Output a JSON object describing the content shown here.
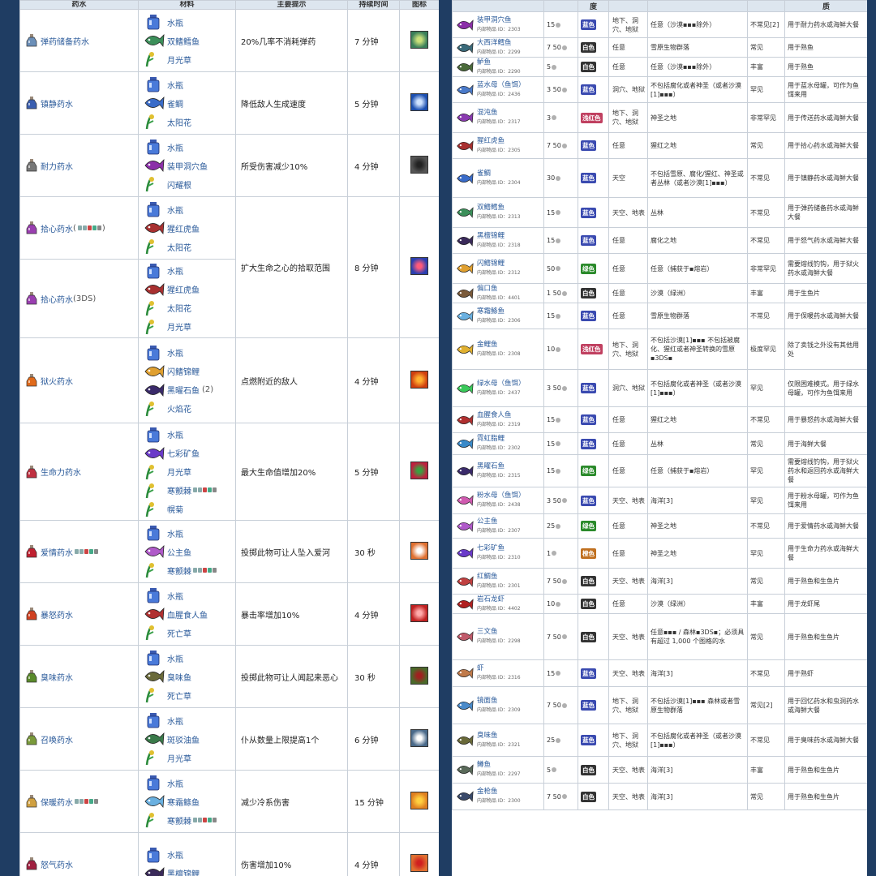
{
  "left": {
    "headers": [
      "药水",
      "材料",
      "主要提示",
      "持续时间",
      "图标"
    ],
    "rows": [
      {
        "name": "弹药储备药水",
        "pcolor": "#6b8fb8",
        "ings": [
          {
            "name": "水瓶",
            "ic": "bottle"
          },
          {
            "name": "双鳍鳕鱼",
            "ic": "#3c8f5a"
          },
          {
            "name": "月光草",
            "ic": "herb"
          }
        ],
        "effect": "20%几率不消耗弹药",
        "dur": "7 分钟",
        "buff": [
          "#3a7f5a",
          "#c9e07a"
        ]
      },
      {
        "name": "镇静药水",
        "pcolor": "#3b5fb0",
        "ings": [
          {
            "name": "水瓶",
            "ic": "bottle"
          },
          {
            "name": "雀鲷",
            "ic": "#3a6cc9"
          },
          {
            "name": "太阳花",
            "ic": "herb"
          }
        ],
        "effect": "降低敌人生成速度",
        "dur": "5 分钟",
        "buff": [
          "#1c4fb0",
          "#cfe3ff"
        ]
      },
      {
        "name": "耐力药水",
        "pcolor": "#777777",
        "ings": [
          {
            "name": "水瓶",
            "ic": "bottle"
          },
          {
            "name": "装甲洞穴鱼",
            "ic": "#8b2fa8"
          },
          {
            "name": "闪耀根",
            "ic": "herb"
          }
        ],
        "effect": "所受伤害减少10%",
        "dur": "4 分钟",
        "buff": [
          "#555555",
          "#222222"
        ]
      },
      {
        "name": "拾心药水",
        "ver": "(",
        "verafter": ")",
        "plat": true,
        "pcolor": "#9a3fb0",
        "ings": [
          {
            "name": "水瓶",
            "ic": "bottle"
          },
          {
            "name": "猩红虎鱼",
            "ic": "#a83030"
          },
          {
            "name": "太阳花",
            "ic": "herb"
          }
        ],
        "effect": "扩大生命之心的拾取范围",
        "dur": "8 分钟",
        "buff": [
          "#2a3fb0",
          "#ff5a7a"
        ]
      },
      {
        "name": "拾心药水",
        "ver": "(",
        "verafter": "3DS)",
        "pcolor": "#9a3fb0",
        "ings": [
          {
            "name": "水瓶",
            "ic": "bottle"
          },
          {
            "name": "猩红虎鱼",
            "ic": "#a83030"
          },
          {
            "name": "太阳花",
            "ic": "herb"
          },
          {
            "name": "月光草",
            "ic": "herb"
          }
        ]
      },
      {
        "name": "狱火药水",
        "pcolor": "#e06a1a",
        "ings": [
          {
            "name": "水瓶",
            "ic": "bottle"
          },
          {
            "name": "闪鳍锦鲤",
            "ic": "#e0a030"
          },
          {
            "name": "黑曜石鱼",
            "ic": "#3a2a6a",
            "cnt": "(2)"
          },
          {
            "name": "火焰花",
            "ic": "herb"
          }
        ],
        "effect": "点燃附近的敌人",
        "dur": "4 分钟",
        "buff": [
          "#d04010",
          "#ffb030"
        ]
      },
      {
        "name": "生命力药水",
        "pcolor": "#c03040",
        "ings": [
          {
            "name": "水瓶",
            "ic": "bottle"
          },
          {
            "name": "七彩矿鱼",
            "ic": "#6a3ac9"
          },
          {
            "name": "月光草",
            "ic": "herb"
          },
          {
            "name": "寒颤棘",
            "ic": "herb",
            "plat": true
          },
          {
            "name": "幌菊",
            "ic": "herb"
          }
        ],
        "effect": "最大生命值增加20%",
        "dur": "5 分钟",
        "buff": [
          "#c02040",
          "#3aa040"
        ]
      },
      {
        "name": "爱情药水",
        "plat": true,
        "pcolor": "#c02030",
        "ings": [
          {
            "name": "水瓶",
            "ic": "bottle"
          },
          {
            "name": "公主鱼",
            "ic": "#b05ac9"
          },
          {
            "name": "寒颤棘",
            "ic": "herb",
            "plat": true
          }
        ],
        "effect": "投掷此物可让人坠入爱河",
        "dur": "30 秒",
        "buff": [
          "#e07030",
          "#ffffff"
        ]
      },
      {
        "name": "暴怒药水",
        "pcolor": "#d04020",
        "ings": [
          {
            "name": "水瓶",
            "ic": "bottle"
          },
          {
            "name": "血腥食人鱼",
            "ic": "#b03030"
          },
          {
            "name": "死亡草",
            "ic": "herb"
          }
        ],
        "effect": "暴击率增加10%",
        "dur": "4 分钟",
        "buff": [
          "#c02020",
          "#ffaaaa"
        ]
      },
      {
        "name": "臭味药水",
        "pcolor": "#5a8a2a",
        "ings": [
          {
            "name": "水瓶",
            "ic": "bottle"
          },
          {
            "name": "臭味鱼",
            "ic": "#6a6a3a"
          },
          {
            "name": "死亡草",
            "ic": "herb"
          }
        ],
        "effect": "投掷此物可让人闻起来恶心",
        "dur": "30 秒",
        "buff": [
          "#4a6a2a",
          "#a02020"
        ]
      },
      {
        "name": "召唤药水",
        "pcolor": "#7a9a3a",
        "ings": [
          {
            "name": "水瓶",
            "ic": "bottle"
          },
          {
            "name": "斑驳油鱼",
            "ic": "#3a7a4a"
          },
          {
            "name": "月光草",
            "ic": "herb"
          }
        ],
        "effect": "仆从数量上限提高1个",
        "dur": "6 分钟",
        "buff": [
          "#4a6a8a",
          "#ffffff"
        ]
      },
      {
        "name": "保暖药水",
        "plat": true,
        "pcolor": "#d0a040",
        "ings": [
          {
            "name": "水瓶",
            "ic": "bottle"
          },
          {
            "name": "寒霜鲦鱼",
            "ic": "#6ab0e0"
          },
          {
            "name": "寒颤棘",
            "ic": "herb",
            "plat": true
          }
        ],
        "effect": "减少冷系伤害",
        "dur": "15 分钟",
        "buff": [
          "#e08020",
          "#ffd040"
        ]
      },
      {
        "name": "怒气药水",
        "pcolor": "#a02040",
        "ings": [
          {
            "name": "水瓶",
            "ic": "bottle"
          },
          {
            "name": "黑檀锦鲤",
            "ic": "#3a2a5a"
          }
        ],
        "effect": "伤害增加10%",
        "dur": "4 分钟",
        "buff": [
          "#e07030",
          "#d02020"
        ]
      }
    ]
  },
  "right": {
    "headers": [
      "",
      "",
      "度",
      "",
      "",
      "",
      "质",
      ""
    ],
    "rows": [
      {
        "n": "装甲洞穴鱼",
        "id": "内部物品 ID：2303",
        "fc": "#8b2fa8",
        "p": "15",
        "rar": "蓝色",
        "rc": "#3a4ab0",
        "env": "地下、洞穴、地狱",
        "cond": "任意（沙漠▪▪▪除外）",
        "fr": "不常见[2]",
        "use": "用于耐力药水或海鲜大餐"
      },
      {
        "n": "大西洋鳕鱼",
        "id": "内部物品 ID：2299",
        "fc": "#3a6a7a",
        "p": "7 50",
        "rar": "白色",
        "rc": "#333",
        "env": "任意",
        "cond": "雪原生物群落",
        "fr": "常见",
        "use": "用于熟鱼"
      },
      {
        "n": "鲈鱼",
        "id": "内部物品 ID：2290",
        "fc": "#4a6a3a",
        "p": "5",
        "rar": "白色",
        "rc": "#333",
        "env": "任意",
        "cond": "任意（沙漠▪▪▪除外）",
        "fr": "丰富",
        "use": "用于熟鱼"
      },
      {
        "n": "蓝水母（鱼饵）",
        "id": "内部物品 ID：2436",
        "fc": "#4a7ac9",
        "p": "3 50",
        "rar": "蓝色",
        "rc": "#3a4ab0",
        "env": "洞穴、地狱",
        "cond": "不包括腐化或者神圣（或者沙漠[1]▪▪▪）",
        "fr": "罕见",
        "use": "用于蓝水母罐，可作为鱼饵来用"
      },
      {
        "n": "混沌鱼",
        "id": "内部物品 ID：2317",
        "fc": "#8a3ab0",
        "p": "3",
        "rar": "浅红色",
        "rc": "#c04060",
        "env": "地下、洞穴、地狱",
        "cond": "神圣之地",
        "fr": "非常罕见",
        "use": "用于传送药水或海鲜大餐"
      },
      {
        "n": "猩红虎鱼",
        "id": "内部物品 ID：2305",
        "fc": "#a83030",
        "p": "7 50",
        "rar": "蓝色",
        "rc": "#3a4ab0",
        "env": "任意",
        "cond": "猩红之地",
        "fr": "常见",
        "use": "用于拾心药水或海鲜大餐"
      },
      {
        "n": "雀鲷",
        "id": "内部物品 ID：2304",
        "fc": "#3a6cc9",
        "p": "30",
        "rar": "蓝色",
        "rc": "#3a4ab0",
        "env": "天空",
        "cond": "不包括雪原、腐化/猩红、神圣或者丛林（或者沙漠[1]▪▪▪）",
        "fr": "不常见",
        "use": "用于镇静药水或海鲜大餐"
      },
      {
        "n": "双鳍鳕鱼",
        "id": "内部物品 ID：2313",
        "fc": "#3c8f5a",
        "p": "15",
        "rar": "蓝色",
        "rc": "#3a4ab0",
        "env": "天空、地表",
        "cond": "丛林",
        "fr": "不常见",
        "use": "用于弹药储备药水或海鲜大餐"
      },
      {
        "n": "黑檀锦鲤",
        "id": "内部物品 ID：2318",
        "fc": "#3a2a5a",
        "p": "15",
        "rar": "蓝色",
        "rc": "#3a4ab0",
        "env": "任意",
        "cond": "腐化之地",
        "fr": "不常见",
        "use": "用于怒气药水或海鲜大餐"
      },
      {
        "n": "闪鳍锦鲤",
        "id": "内部物品 ID：2312",
        "fc": "#e0a030",
        "p": "50",
        "rar": "绿色",
        "rc": "#2a8a2a",
        "env": "任意",
        "cond": "任意（捕获于▪熔岩）",
        "fr": "非常罕见",
        "use": "需要熔线钓钩，用于狱火药水或海鲜大餐"
      },
      {
        "n": "偏口鱼",
        "id": "内部物品 ID：4401",
        "fc": "#7a5a3a",
        "p": "1 50",
        "rar": "白色",
        "rc": "#333",
        "env": "任意",
        "cond": "沙漠（绿洲）",
        "fr": "丰富",
        "use": "用于生鱼片"
      },
      {
        "n": "寒霜鲦鱼",
        "id": "内部物品 ID：2306",
        "fc": "#6ab0e0",
        "p": "15",
        "rar": "蓝色",
        "rc": "#3a4ab0",
        "env": "任意",
        "cond": "雪原生物群落",
        "fr": "不常见",
        "use": "用于保暖药水或海鲜大餐"
      },
      {
        "n": "金鲤鱼",
        "id": "内部物品 ID：2308",
        "fc": "#e0b030",
        "p": "10",
        "rar": "浅红色",
        "rc": "#c04060",
        "env": "地下、洞穴、地狱",
        "cond": "不包括沙漠[1]▪▪▪ 不包括被腐化、猩红或者神圣转换的雪原▪3DS▪",
        "fr": "极度罕见",
        "use": "除了卖钱之外没有其他用处"
      },
      {
        "n": "绿水母（鱼饵）",
        "id": "内部物品 ID：2437",
        "fc": "#3ac95a",
        "p": "3 50",
        "rar": "蓝色",
        "rc": "#3a4ab0",
        "env": "洞穴、地狱",
        "cond": "不包括腐化或者神圣（或者沙漠[1]▪▪▪）",
        "fr": "罕见",
        "use": "仅限困难模式。用于绿水母罐，可作为鱼饵来用"
      },
      {
        "n": "血腥食人鱼",
        "id": "内部物品 ID：2319",
        "fc": "#b03030",
        "p": "15",
        "rar": "蓝色",
        "rc": "#3a4ab0",
        "env": "任意",
        "cond": "猩红之地",
        "fr": "不常见",
        "use": "用于暴怒药水或海鲜大餐"
      },
      {
        "n": "霓虹脂鲤",
        "id": "内部物品 ID：2302",
        "fc": "#3a8ac9",
        "p": "15",
        "rar": "蓝色",
        "rc": "#3a4ab0",
        "env": "任意",
        "cond": "丛林",
        "fr": "常见",
        "use": "用于海鲜大餐"
      },
      {
        "n": "黑曜石鱼",
        "id": "内部物品 ID：2315",
        "fc": "#3a2a6a",
        "p": "15",
        "rar": "绿色",
        "rc": "#2a8a2a",
        "env": "任意",
        "cond": "任意（捕获于▪熔岩）",
        "fr": "罕见",
        "use": "需要熔线钓钩，用于狱火药水和返回药水或海鲜大餐"
      },
      {
        "n": "粉水母（鱼饵）",
        "id": "内部物品 ID：2438",
        "fc": "#d05ab0",
        "p": "3 50",
        "rar": "蓝色",
        "rc": "#3a4ab0",
        "env": "天空、地表",
        "cond": "海洋[3]",
        "fr": "罕见",
        "use": "用于粉水母罐，可作为鱼饵来用"
      },
      {
        "n": "公主鱼",
        "id": "内部物品 ID：2307",
        "fc": "#b05ac9",
        "p": "25",
        "rar": "绿色",
        "rc": "#2a8a2a",
        "env": "任意",
        "cond": "神圣之地",
        "fr": "不常见",
        "use": "用于爱情药水或海鲜大餐"
      },
      {
        "n": "七彩矿鱼",
        "id": "内部物品 ID：2310",
        "fc": "#6a3ac9",
        "p": "1",
        "rar": "橙色",
        "rc": "#c07020",
        "env": "任意",
        "cond": "神圣之地",
        "fr": "罕见",
        "use": "用于生命力药水或海鲜大餐"
      },
      {
        "n": "红鲷鱼",
        "id": "内部物品 ID：2301",
        "fc": "#c04040",
        "p": "7 50",
        "rar": "白色",
        "rc": "#333",
        "env": "天空、地表",
        "cond": "海洋[3]",
        "fr": "常见",
        "use": "用于熟鱼和生鱼片"
      },
      {
        "n": "岩石龙虾",
        "id": "内部物品 ID：4402",
        "fc": "#b02020",
        "p": "10",
        "rar": "白色",
        "rc": "#333",
        "env": "任意",
        "cond": "沙漠（绿洲）",
        "fr": "丰富",
        "use": "用于龙虾尾"
      },
      {
        "n": "三文鱼",
        "id": "内部物品 ID：2298",
        "fc": "#c05a6a",
        "p": "7 50",
        "rar": "白色",
        "rc": "#333",
        "env": "天空、地表",
        "cond": "任意▪▪▪ / 森林▪3DS▪；必须具有超过 1,000 个图格的水",
        "fr": "常见",
        "use": "用于熟鱼和生鱼片"
      },
      {
        "n": "虾",
        "id": "内部物品 ID：2316",
        "fc": "#c07a4a",
        "p": "15",
        "rar": "蓝色",
        "rc": "#3a4ab0",
        "env": "天空、地表",
        "cond": "海洋[3]",
        "fr": "不常见",
        "use": "用于熟虾"
      },
      {
        "n": "镜面鱼",
        "id": "内部物品 ID：2309",
        "fc": "#4a8ac9",
        "p": "7 50",
        "rar": "蓝色",
        "rc": "#3a4ab0",
        "env": "地下、洞穴、地狱",
        "cond": "不包括沙漠[1]▪▪▪ 森林或者雪原生物群落",
        "fr": "常见[2]",
        "use": "用于回忆药水和虫洞药水或海鲜大餐"
      },
      {
        "n": "臭味鱼",
        "id": "内部物品 ID：2321",
        "fc": "#6a6a3a",
        "p": "25",
        "rar": "蓝色",
        "rc": "#3a4ab0",
        "env": "地下、洞穴、地狱",
        "cond": "不包括腐化或者神圣（或者沙漠[1]▪▪▪）",
        "fr": "不常见",
        "use": "用于臭味药水或海鲜大餐"
      },
      {
        "n": "鳟鱼",
        "id": "内部物品 ID：2297",
        "fc": "#5a6a5a",
        "p": "5",
        "rar": "白色",
        "rc": "#333",
        "env": "天空、地表",
        "cond": "海洋[3]",
        "fr": "丰富",
        "use": "用于熟鱼和生鱼片"
      },
      {
        "n": "金枪鱼",
        "id": "内部物品 ID：2300",
        "fc": "#3a4a6a",
        "p": "7 50",
        "rar": "白色",
        "rc": "#333",
        "env": "天空、地表",
        "cond": "海洋[3]",
        "fr": "常见",
        "use": "用于熟鱼和生鱼片"
      }
    ]
  }
}
